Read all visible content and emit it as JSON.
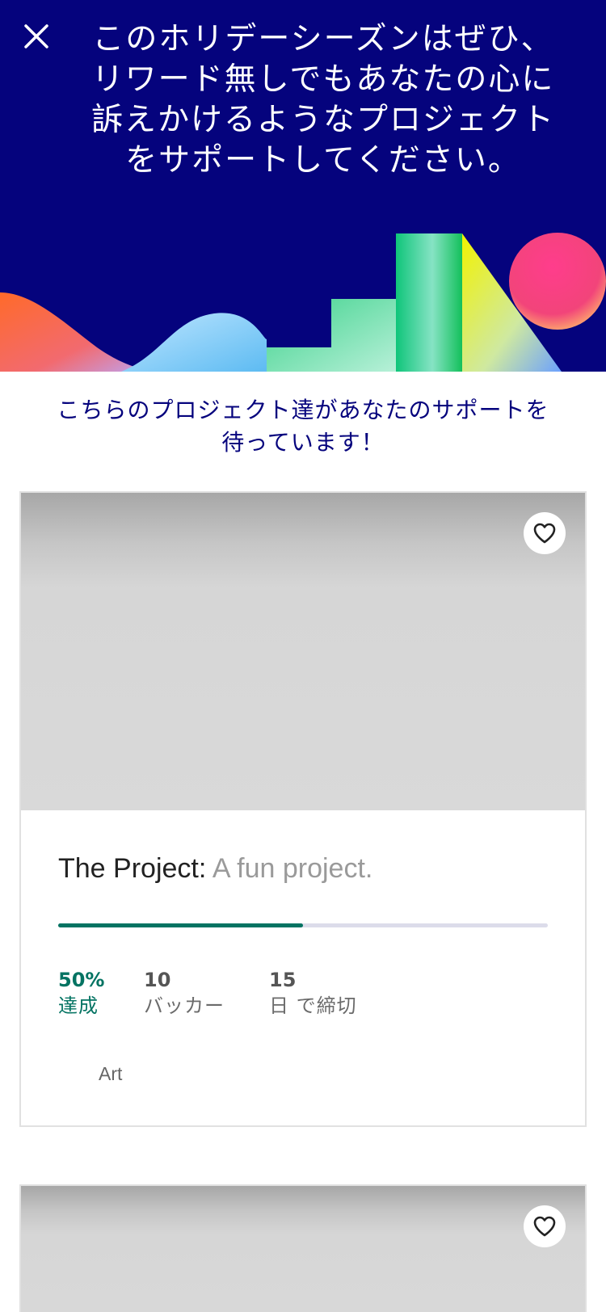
{
  "header": {
    "title": "このホリデーシーズンはぜひ、\nリワード無しでもあなたの心に\n訴えかけるようなプロジェクト\nをサポートしてください。",
    "close_icon": "close-icon",
    "background_color": "#05037d"
  },
  "subheading": "こちらのプロジェクト達があなたのサポートを\n待っています！",
  "projects": [
    {
      "name": "The Project:",
      "blurb": " A fun project.",
      "funded_percent": 50,
      "funded_value": "50%",
      "funded_label": "達成",
      "backers_value": "10",
      "backers_label": "バッカー",
      "days_value": "15",
      "days_label": "日 で締切",
      "category": "Art",
      "favorite_icon": "heart-outline-icon"
    },
    {
      "favorite_icon": "heart-outline-icon"
    }
  ],
  "colors": {
    "brand_navy": "#05037d",
    "progress": "#037362",
    "progress_track": "#dcdcea"
  }
}
